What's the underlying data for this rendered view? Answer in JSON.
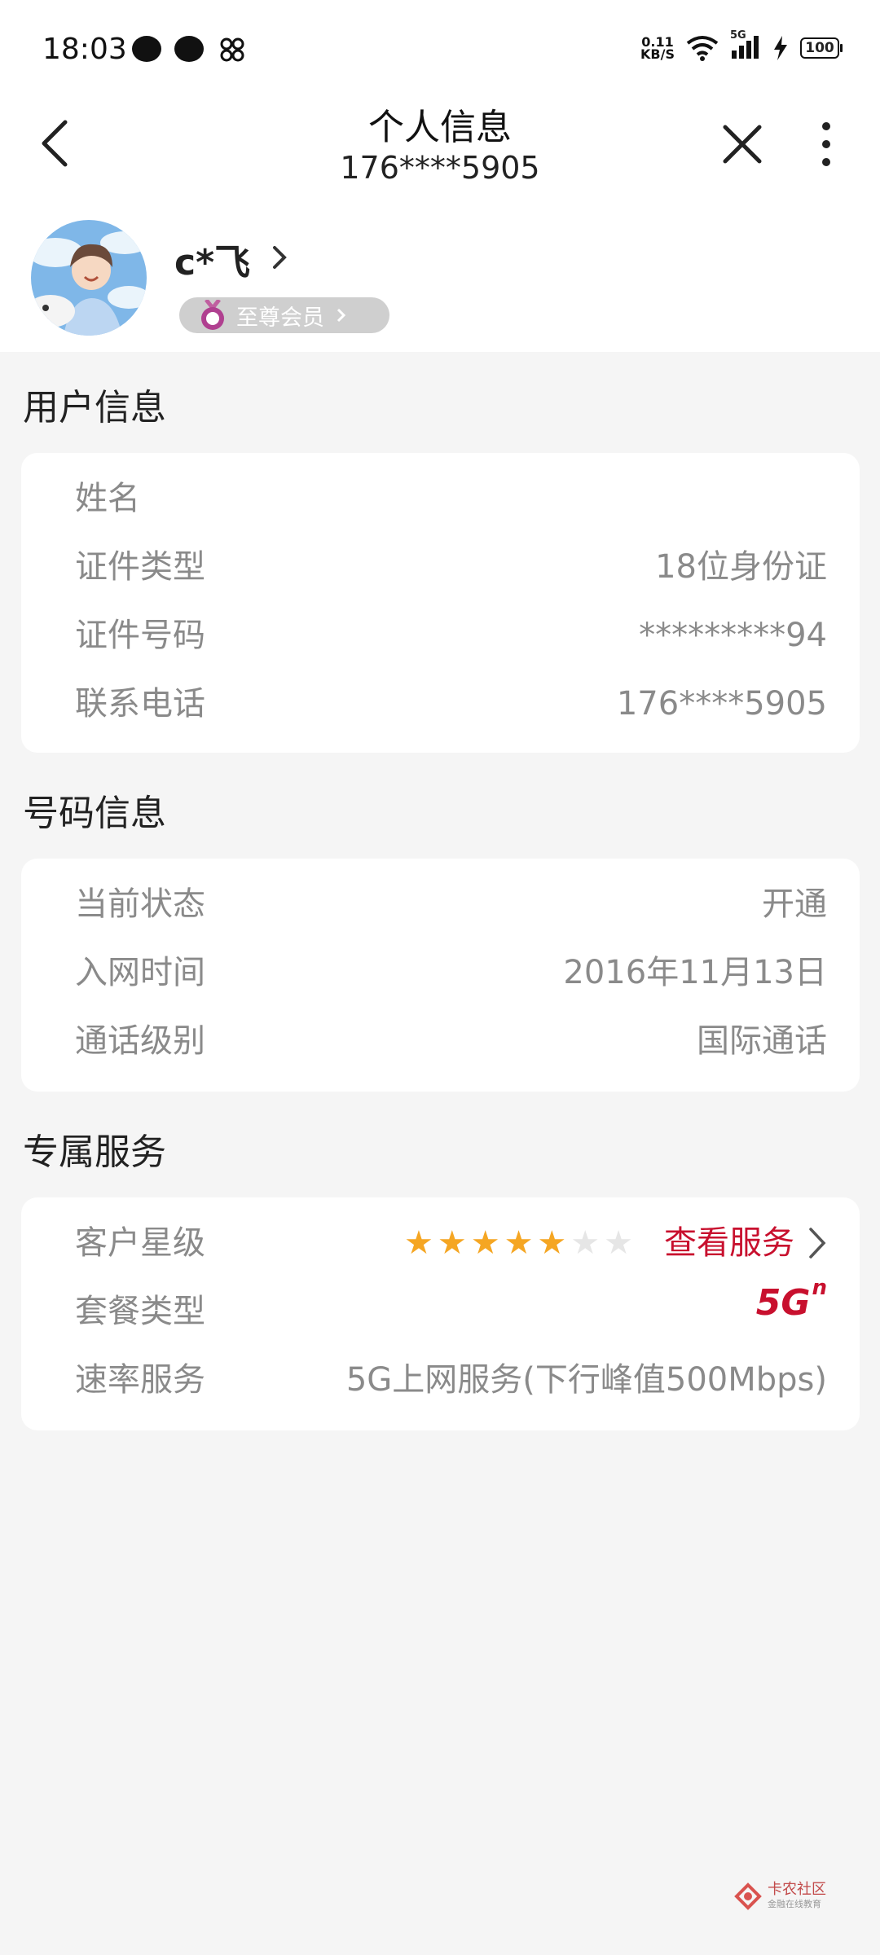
{
  "status_bar": {
    "time": "18:03",
    "net_speed_value": "0.11",
    "net_speed_unit": "KB/S",
    "network": "5G",
    "battery": "100"
  },
  "header": {
    "title": "个人信息",
    "subtitle": "176****5905"
  },
  "profile": {
    "username": "c*飞",
    "vip_label": "至尊会员"
  },
  "sections": {
    "user_info": {
      "title": "用户信息",
      "rows": [
        {
          "label": "姓名",
          "value": ""
        },
        {
          "label": "证件类型",
          "value": "18位身份证"
        },
        {
          "label": "证件号码",
          "value": "*********94"
        },
        {
          "label": "联系电话",
          "value": "176****5905"
        }
      ]
    },
    "number_info": {
      "title": "号码信息",
      "rows": [
        {
          "label": "当前状态",
          "value": "开通"
        },
        {
          "label": "入网时间",
          "value": "2016年11月13日"
        },
        {
          "label": "通话级别",
          "value": "国际通话"
        }
      ]
    },
    "exclusive": {
      "title": "专属服务",
      "star_level_label": "客户星级",
      "stars_filled": 5,
      "stars_total": 7,
      "view_service_label": "查看服务",
      "plan_type_label": "套餐类型",
      "plan_badge_main": "5G",
      "plan_badge_sup": "n",
      "speed_label": "速率服务",
      "speed_value": "5G上网服务(下行峰值500Mbps)"
    }
  },
  "watermark": {
    "text": "卡农社区",
    "sub": "金融在线教育"
  },
  "colors": {
    "accent_red": "#c8102e",
    "star_filled": "#f5a623",
    "star_empty": "#e6e6e6",
    "label_gray": "#8a8a8a"
  }
}
